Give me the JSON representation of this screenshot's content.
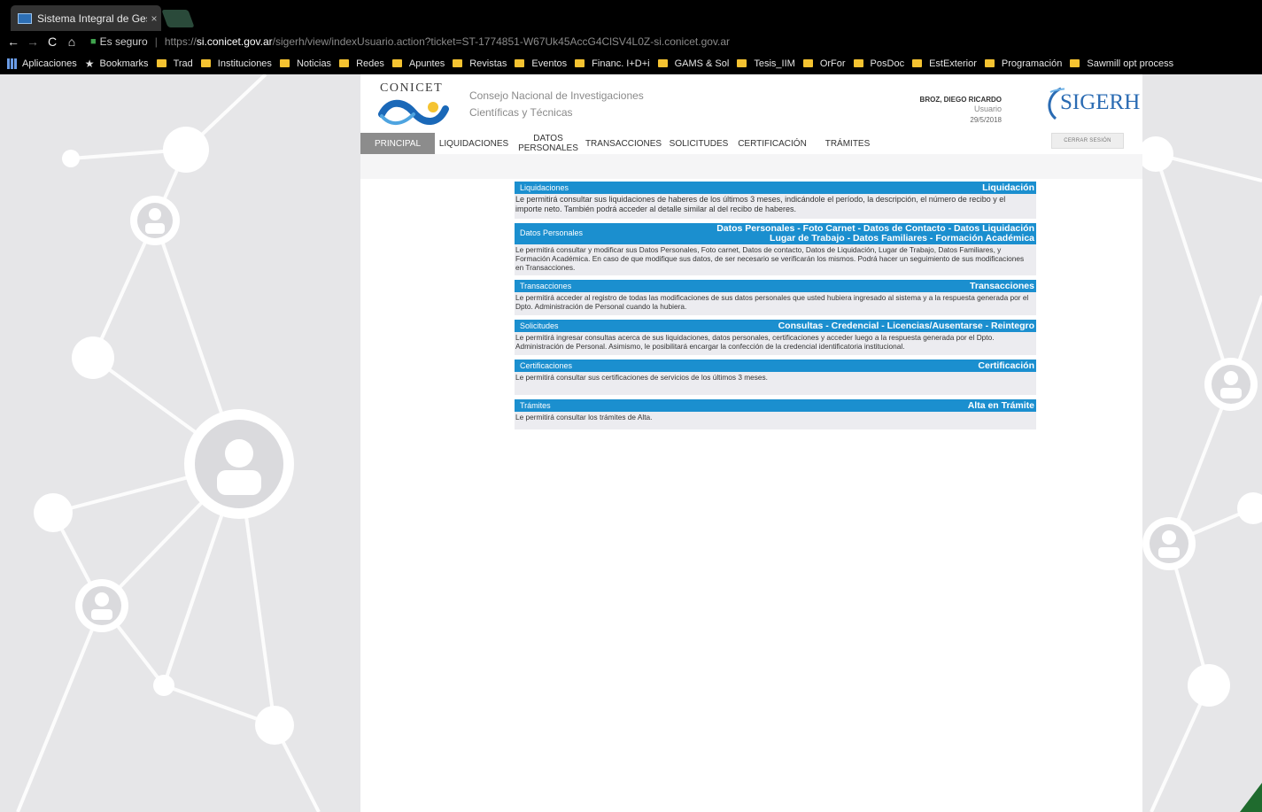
{
  "browser": {
    "tab_title": "Sistema Integral de Gesti",
    "tab_close": "×",
    "secure_label": "Es seguro",
    "url_scheme": "https://",
    "url_domain": "si.conicet.gov.ar",
    "url_path": "/sigerh/view/indexUsuario.action?ticket=ST-1774851-W67Uk45AccG4ClSV4L0Z-si.conicet.gov.ar",
    "bookmarks": [
      "Aplicaciones",
      "Bookmarks",
      "Trad",
      "Instituciones",
      "Noticias",
      "Redes",
      "Apuntes",
      "Revistas",
      "Eventos",
      "Financ. I+D+i",
      "GAMS & Sol",
      "Tesis_IIM",
      "OrFor",
      "PosDoc",
      "EstExterior",
      "Programación",
      "Sawmill opt process"
    ]
  },
  "header": {
    "brand": "CONICET",
    "org_line1": "Consejo Nacional de Investigaciones",
    "org_line2": "Científicas y Técnicas",
    "user_name": "BROZ, DIEGO RICARDO",
    "user_role": "Usuario",
    "date": "29/5/2018",
    "app_logo": "SIGERH",
    "logout": "CERRAR SESIÓN"
  },
  "nav": {
    "principal": "PRINCIPAL",
    "liquidaciones": "LIQUIDACIONES",
    "datos_1": "DATOS",
    "datos_2": "PERSONALES",
    "transacciones": "TRANSACCIONES",
    "solicitudes": "SOLICITUDES",
    "certificacion": "CERTIFICACIÓN",
    "tramites": "TRÁMITES"
  },
  "sections": [
    {
      "title": "Liquidaciones",
      "links": "Liquidación",
      "body": "Le permitirá consultar sus liquidaciones de haberes de los últimos 3 meses, indicándole el período, la descripción, el número de recibo y el importe neto. También podrá acceder al detalle similar al del recibo de haberes."
    },
    {
      "title": "Datos Personales",
      "links": "Datos Personales - Foto Carnet - Datos de Contacto - Datos Liquidación",
      "links2": "Lugar de Trabajo - Datos Familiares - Formación Académica",
      "body": "Le permitirá consultar y modificar sus Datos Personales, Foto carnet, Datos de contacto, Datos de Liquidación, Lugar de Trabajo, Datos Familiares, y Formación Académica. En caso de que modifique sus datos, de ser necesario se verificarán los mismos. Podrá hacer un seguimiento de sus modificaciones en Transacciones."
    },
    {
      "title": "Transacciones",
      "links": "Transacciones",
      "body": "Le permitirá acceder al registro de todas las modificaciones de sus datos personales que usted hubiera ingresado al sistema y a la respuesta generada por el Dpto. Administración de Personal cuando la hubiera."
    },
    {
      "title": "Solicitudes",
      "links": "Consultas - Credencial - Licencias/Ausentarse - Reintegro",
      "body": "Le permitirá ingresar consultas acerca de sus liquidaciones, datos personales, certificaciones y acceder luego a la respuesta generada por el Dpto. Administración de Personal. Asimismo, le posibilitará encargar la confección de la credencial identificatoria institucional."
    },
    {
      "title": "Certificaciones",
      "links": "Certificación",
      "body": "Le permitirá consultar sus certificaciones de servicios de los últimos 3 meses."
    },
    {
      "title": "Trámites",
      "links": "Alta en Trámite",
      "body": "Le permitirá consultar los trámites de Alta."
    }
  ],
  "colors": {
    "section_header": "#1b8fcf",
    "section_body": "#ececf0",
    "active_tab": "#8c8c8c",
    "logo_blue": "#2a6bb3"
  }
}
